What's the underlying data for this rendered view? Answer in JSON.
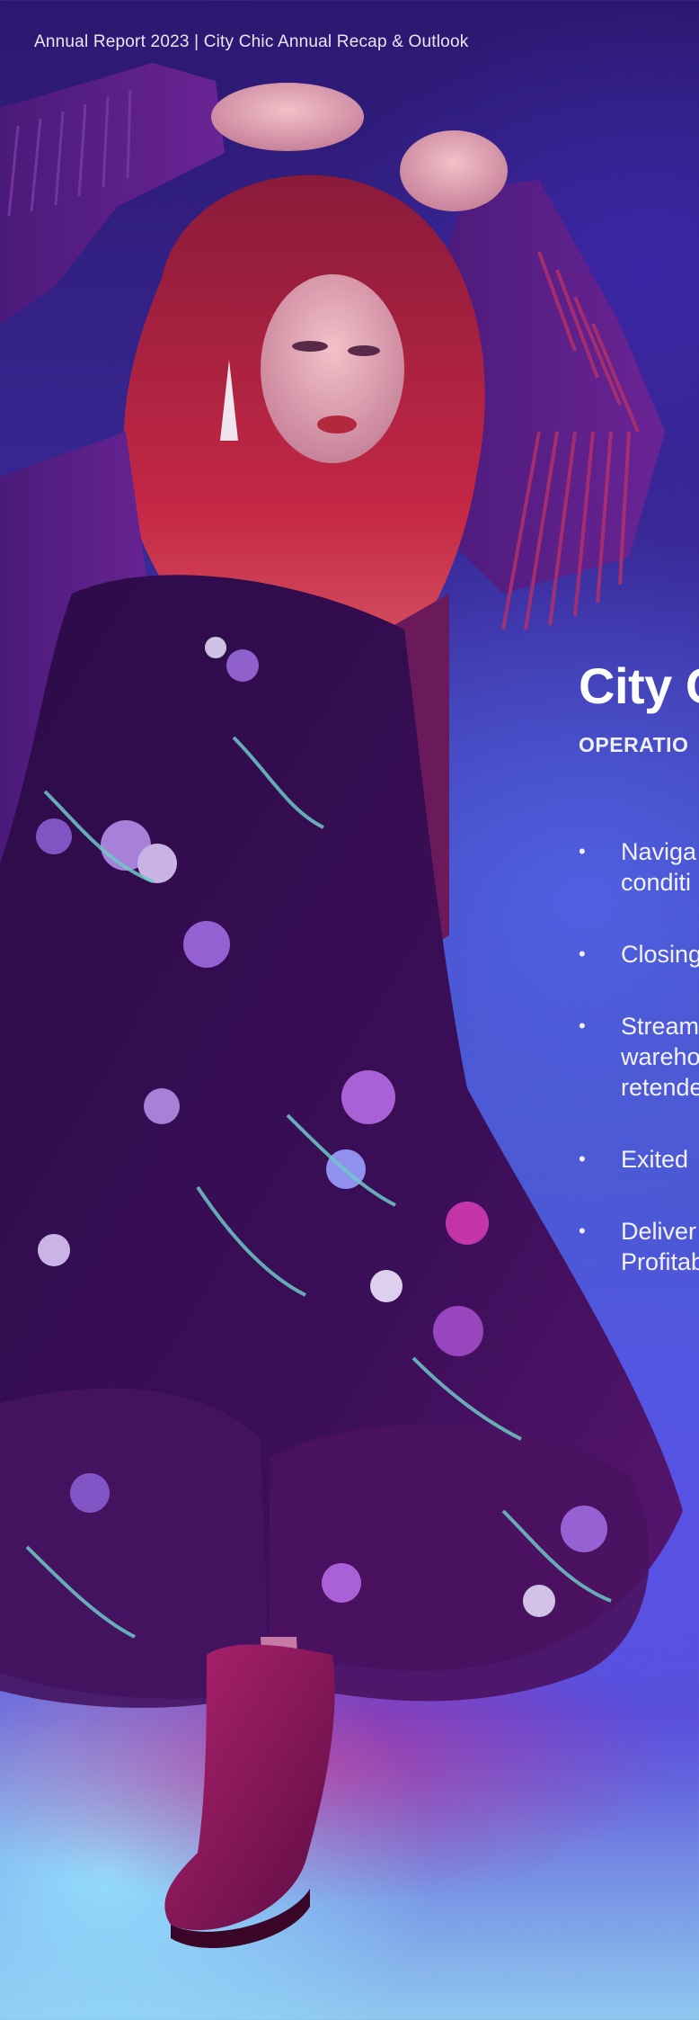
{
  "header": {
    "text": "Annual Report 2023 | City Chic Annual Recap & Outlook"
  },
  "main": {
    "title": "City C",
    "subtitle": "OPERATIO",
    "bullets": [
      {
        "text": "Naviga\nconditi"
      },
      {
        "text": "Closing"
      },
      {
        "text": "Stream\nwareho\nretende"
      },
      {
        "text": "Exited"
      },
      {
        "text": "Deliver\nProfitab"
      }
    ]
  },
  "colors": {
    "background_top": "#2c1870",
    "background_mid": "#4a55cc",
    "background_bottom": "#8fc8ef",
    "dress": "#3a0f56",
    "jacket": "#5a1d86",
    "hair": "#b0203e",
    "boot": "#8a1660"
  }
}
